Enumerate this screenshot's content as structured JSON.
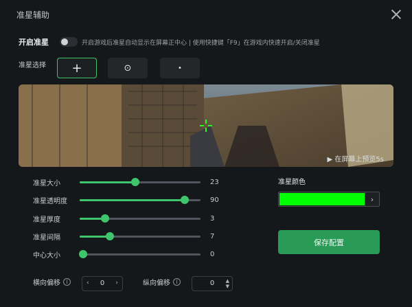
{
  "window": {
    "title": "准星辅助"
  },
  "enable": {
    "label": "开启准星",
    "hint": "开启游戏后准星自动显示在屏幕正中心 | 使用快捷键「F9」在游戏内快速开启/关闭准星",
    "enabled": false
  },
  "style": {
    "label": "准星选择",
    "options": [
      {
        "glyph": "+",
        "icon": "crosshair-plus-icon",
        "selected": true
      },
      {
        "glyph": "⊙",
        "icon": "crosshair-circle-dot-icon",
        "selected": false
      },
      {
        "glyph": "•",
        "icon": "crosshair-dot-icon",
        "selected": false
      }
    ]
  },
  "preview": {
    "note": "▶ 在屏幕上预览5s"
  },
  "sliders": [
    {
      "label": "准星大小",
      "value": 23,
      "fill_fraction": 0.46
    },
    {
      "label": "准星透明度",
      "value": 90,
      "fill_fraction": 0.87
    },
    {
      "label": "准星厚度",
      "value": 3,
      "fill_fraction": 0.21
    },
    {
      "label": "准星间隔",
      "value": 7,
      "fill_fraction": 0.25
    },
    {
      "label": "中心大小",
      "value": 0,
      "fill_fraction": 0.03
    }
  ],
  "color": {
    "label": "准星颜色",
    "value": "#00ff00",
    "chevron": "›"
  },
  "save": {
    "label": "保存配置"
  },
  "offsets": {
    "horizontal": {
      "label": "横向偏移",
      "value": "0",
      "left_arrow": "‹",
      "right_arrow": "›"
    },
    "vertical": {
      "label": "纵向偏移",
      "value": "0",
      "up_arrow": "▲",
      "down_arrow": "▼"
    }
  },
  "colors": {
    "accent": "#3fc56c",
    "save_button": "#2a9a57",
    "background": "#15181a"
  }
}
